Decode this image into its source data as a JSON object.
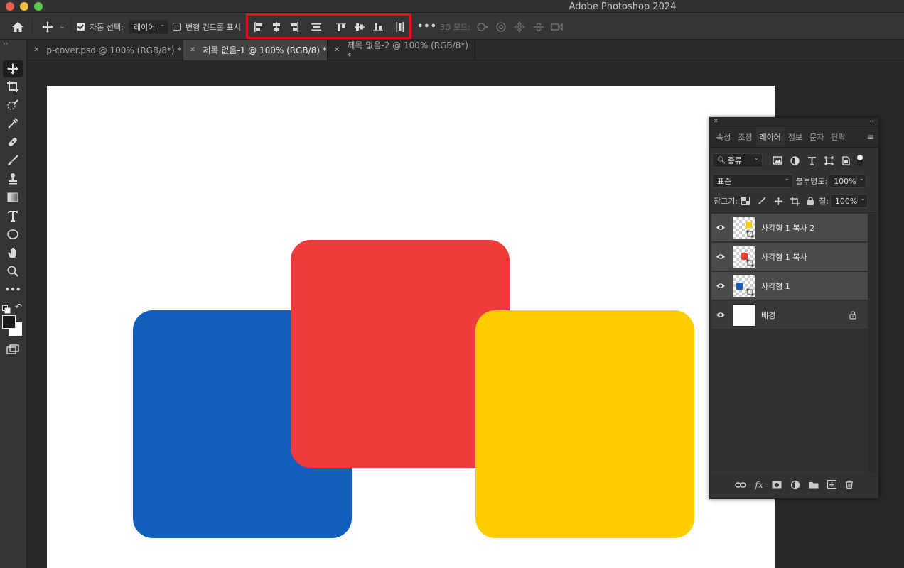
{
  "window": {
    "title": "Adobe Photoshop 2024"
  },
  "options_bar": {
    "auto_select_label": "자동 선택:",
    "auto_select_value": "레이어",
    "transform_controls_label": "변형 컨트롤 표시",
    "more_label": "•••",
    "mode_3d_label": "3D 모드:",
    "align_buttons": [
      "align-left-edges",
      "align-horizontal-centers",
      "align-right-edges",
      "distribute-horizontal",
      "align-top-edges",
      "align-vertical-centers",
      "align-bottom-edges",
      "distribute-vertical"
    ],
    "highlight_color": "#e1131c"
  },
  "tabs": [
    {
      "label": "p-cover.psd @ 100% (RGB/8*) *",
      "active": false
    },
    {
      "label": "제목 없음-1 @ 100% (RGB/8) *",
      "active": true
    },
    {
      "label": "제목 없음-2 @ 100% (RGB/8*) *",
      "active": false
    }
  ],
  "tools": [
    "move-tool",
    "crop-tool",
    "quick-selection-tool",
    "eyedropper-tool",
    "healing-brush-tool",
    "brush-tool",
    "clone-stamp-tool",
    "gradient-tool",
    "type-tool",
    "ellipse-tool",
    "hand-tool",
    "zoom-tool",
    "more-tools"
  ],
  "canvas": {
    "background": "#ffffff",
    "shapes": [
      {
        "name": "blue-rectangle",
        "color": "#115ebd"
      },
      {
        "name": "red-rectangle",
        "color": "#ee3b3b"
      },
      {
        "name": "yellow-rectangle",
        "color": "#ffcc00"
      }
    ]
  },
  "layers_panel": {
    "tabs": [
      "속성",
      "조정",
      "레이어",
      "정보",
      "문자",
      "단락"
    ],
    "active_tab": "레이어",
    "filter_label": "종류",
    "blend_mode": "표준",
    "opacity_label": "불투명도:",
    "opacity_value": "100%",
    "lock_label": "잠그기:",
    "fill_label": "칠:",
    "fill_value": "100%",
    "layers": [
      {
        "name": "사각형 1 복사 2",
        "swatch": "#ffcc00",
        "selected": true
      },
      {
        "name": "사각형 1 복사",
        "swatch": "#ee3b3b",
        "selected": true
      },
      {
        "name": "사각형 1",
        "swatch": "#115ebd",
        "selected": true
      },
      {
        "name": "배경",
        "swatch": "#ffffff",
        "selected": false,
        "locked": true
      }
    ]
  }
}
